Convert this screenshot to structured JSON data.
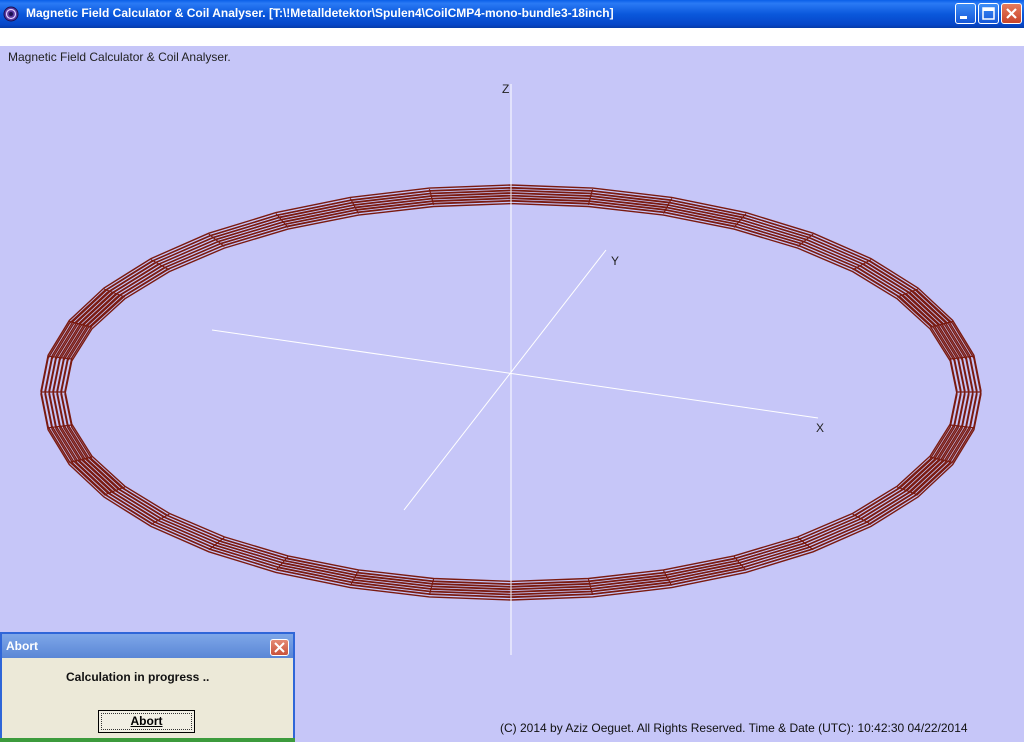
{
  "window": {
    "title": "Magnetic Field Calculator & Coil Analyser.  [T:\\!Metalldetektor\\Spulen4\\CoilCMP4-mono-bundle3-18inch]",
    "controls": [
      "minimize-icon",
      "maximize-icon",
      "close-icon"
    ]
  },
  "canvas": {
    "heading": "Magnetic Field Calculator & Coil Analyser.",
    "background": "#c6c6f8",
    "coil_color": "#7a1a10",
    "axis_color": "#ffffff",
    "axes": {
      "z": "Z",
      "y": "Y",
      "x": "X"
    },
    "footer": "(C) 2014  by Aziz Oeguet. All Rights Reserved.  Time & Date (UTC): 10:42:30  04/22/2014"
  },
  "dialog": {
    "title": "Abort",
    "message": "Calculation in progress ..",
    "button": "Abort"
  }
}
